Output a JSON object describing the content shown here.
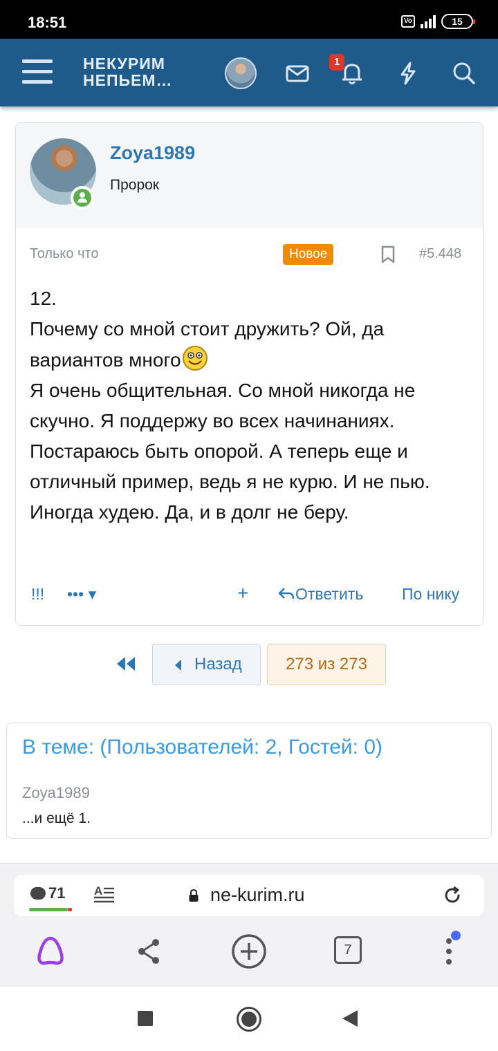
{
  "status_bar": {
    "time": "18:51",
    "volte": "Vo LTE",
    "network": "4G",
    "battery": "15"
  },
  "header": {
    "logo_line1": "НЕКУРИМ",
    "logo_line2": "НЕПЬЕМ…",
    "alerts_count": "1",
    "colors": {
      "header_bg": "#1e5a8a",
      "link": "#2e77b5"
    }
  },
  "post": {
    "username": "Zoya1989",
    "user_title": "Пророк",
    "time": "Только что",
    "new_label": "Новое",
    "post_number": "#5.448",
    "body_lines": [
      "12.",
      "Почему со мной стоит дружить? Ой, да",
      "вариантов много",
      "Я очень общительная. Со мной никогда не скучно. Я поддержу во всех начинаниях. Постараюсь быть опорой. А теперь еще и отличный пример, ведь я не курю. И не пью. Иногда худею. Да, и в долг не беру."
    ],
    "actions": {
      "report": "!!!",
      "more": "•••",
      "multiquote": "+",
      "reply": "Ответить",
      "by_nick": "По нику"
    }
  },
  "pagination": {
    "back_label": "Назад",
    "current": "273 из 273"
  },
  "online_block": {
    "title": "В теме: (Пользователей: 2, Гостей: 0)",
    "user": "Zoya1989",
    "more": "...и ещё 1."
  },
  "browser": {
    "comments_count": "71",
    "reader_icon": "reader-mode-icon",
    "url": "ne-kurim.ru",
    "tabs_count": "7"
  }
}
